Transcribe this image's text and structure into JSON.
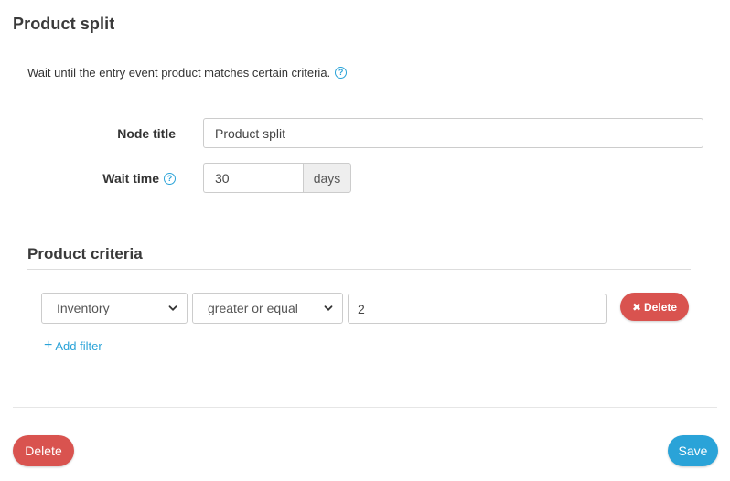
{
  "dialog": {
    "title": "Product split",
    "description": "Wait until the entry event product matches certain criteria."
  },
  "form": {
    "node_title_label": "Node title",
    "node_title_value": "Product split",
    "wait_time_label": "Wait time",
    "wait_time_value": "30",
    "wait_time_unit": "days"
  },
  "criteria": {
    "section_title": "Product criteria",
    "filters": [
      {
        "field": "Inventory",
        "operator": "greater or equal",
        "value": "2",
        "delete_label": "Delete"
      }
    ],
    "add_filter_label": "Add filter"
  },
  "footer": {
    "delete_label": "Delete",
    "save_label": "Save"
  },
  "colors": {
    "accent": "#2aa3d8",
    "danger": "#d9534f"
  },
  "icons": {
    "help": "question-circle-icon",
    "delete": "x-icon",
    "add": "plus-icon",
    "select": "chevron-down-icon"
  }
}
